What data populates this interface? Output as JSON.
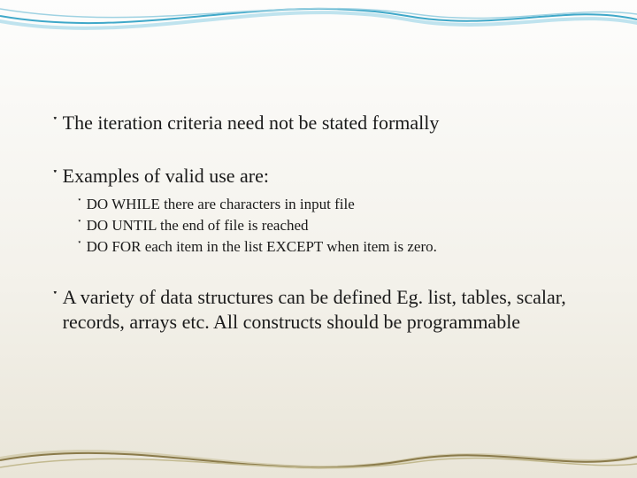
{
  "slide": {
    "bullet_glyph": "་",
    "accent_color_top": "#3fa8c9",
    "accent_color_top_light": "#bfe3ee",
    "accent_color_bottom": "#8a7a4a",
    "accent_color_bottom_light": "#d6cfb3",
    "items": [
      {
        "level": 1,
        "text": "The iteration criteria need not  be stated formally"
      },
      {
        "level": 1,
        "text": " Examples of valid use are:"
      },
      {
        "level": 2,
        "text": "DO  WHILE  there  are characters  in input file"
      },
      {
        "level": 2,
        "text": "DO UNTIL the end of file is reached"
      },
      {
        "level": 2,
        "text": "DO FOR each item in the list EXCEPT when item is zero."
      },
      {
        "level": 1,
        "text": "A  variety  of data structures can be defined Eg.  list, tables, scalar, records, arrays etc. All constructs should be  programmable"
      }
    ]
  }
}
